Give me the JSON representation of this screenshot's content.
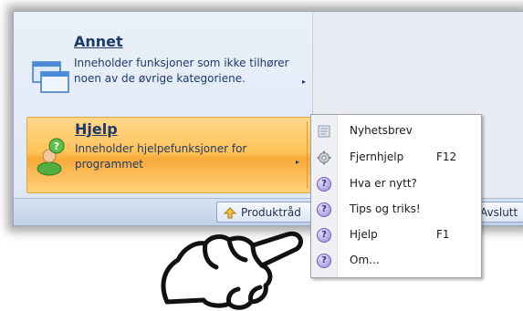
{
  "menu": {
    "items": [
      {
        "title": "Annet",
        "description": "Inneholder funksjoner som ikke tilhører noen av de øvrige kategoriene.",
        "icon": "windows-icon",
        "arrow": "▸"
      },
      {
        "title": "Hjelp",
        "description": "Inneholder hjelpefunksjoner for programmet",
        "icon": "help-person-icon",
        "arrow": "▸",
        "highlighted": true
      }
    ]
  },
  "footer": {
    "product_label": "Produktråd",
    "exit_label": "Avslutt"
  },
  "submenu": {
    "items": [
      {
        "label": "Nyhetsbrev",
        "shortcut": "",
        "icon": "newsletter-icon"
      },
      {
        "label": "Fjernhjelp",
        "shortcut": "F12",
        "icon": "gear-icon"
      },
      {
        "label": "Hva er nytt?",
        "shortcut": "",
        "icon": "question-icon"
      },
      {
        "label": "Tips og triks!",
        "shortcut": "",
        "icon": "question-icon"
      },
      {
        "label": "Hjelp",
        "shortcut": "F1",
        "icon": "question-icon"
      },
      {
        "label": "Om...",
        "shortcut": "",
        "icon": "question-icon"
      }
    ]
  },
  "colors": {
    "highlight": "#ffc45a",
    "text": "#1e3a6b",
    "pane": "#e9f0f9"
  }
}
